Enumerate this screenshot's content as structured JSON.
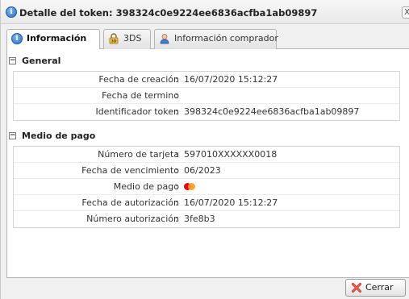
{
  "window": {
    "title": "Detalle del token: 398324c0e9224ee6836acfba1ab09897",
    "close_glyph": "X"
  },
  "tabs": [
    {
      "label": "Información",
      "icon": "info-icon",
      "active": true
    },
    {
      "label": "3DS",
      "icon": "lock-icon",
      "active": false
    },
    {
      "label": "Información comprador",
      "icon": "person-icon",
      "active": false
    }
  ],
  "sections": {
    "general": {
      "title": "General",
      "rows": [
        {
          "label": "Fecha de creación",
          "value": "16/07/2020 15:12:27"
        },
        {
          "label": "Fecha de termino",
          "value": ""
        },
        {
          "label": "Identificador token",
          "value": "398324c0e9224ee6836acfba1ab09897"
        }
      ]
    },
    "payment": {
      "title": "Medio de pago",
      "rows": [
        {
          "label": "Número de tarjeta",
          "value": "597010XXXXXX0018"
        },
        {
          "label": "Fecha de vencimiento",
          "value": "06/2023"
        },
        {
          "label": "Medio de pago",
          "value": "",
          "icon": "mastercard-icon"
        },
        {
          "label": "Fecha de autorización",
          "value": "16/07/2020 15:12:27"
        },
        {
          "label": "Número autorización",
          "value": "3fe8b3"
        }
      ]
    }
  },
  "footer": {
    "close_label": "Cerrar"
  },
  "colors": {
    "accent": "#2a6fc5",
    "close_x": "#d9261c"
  }
}
